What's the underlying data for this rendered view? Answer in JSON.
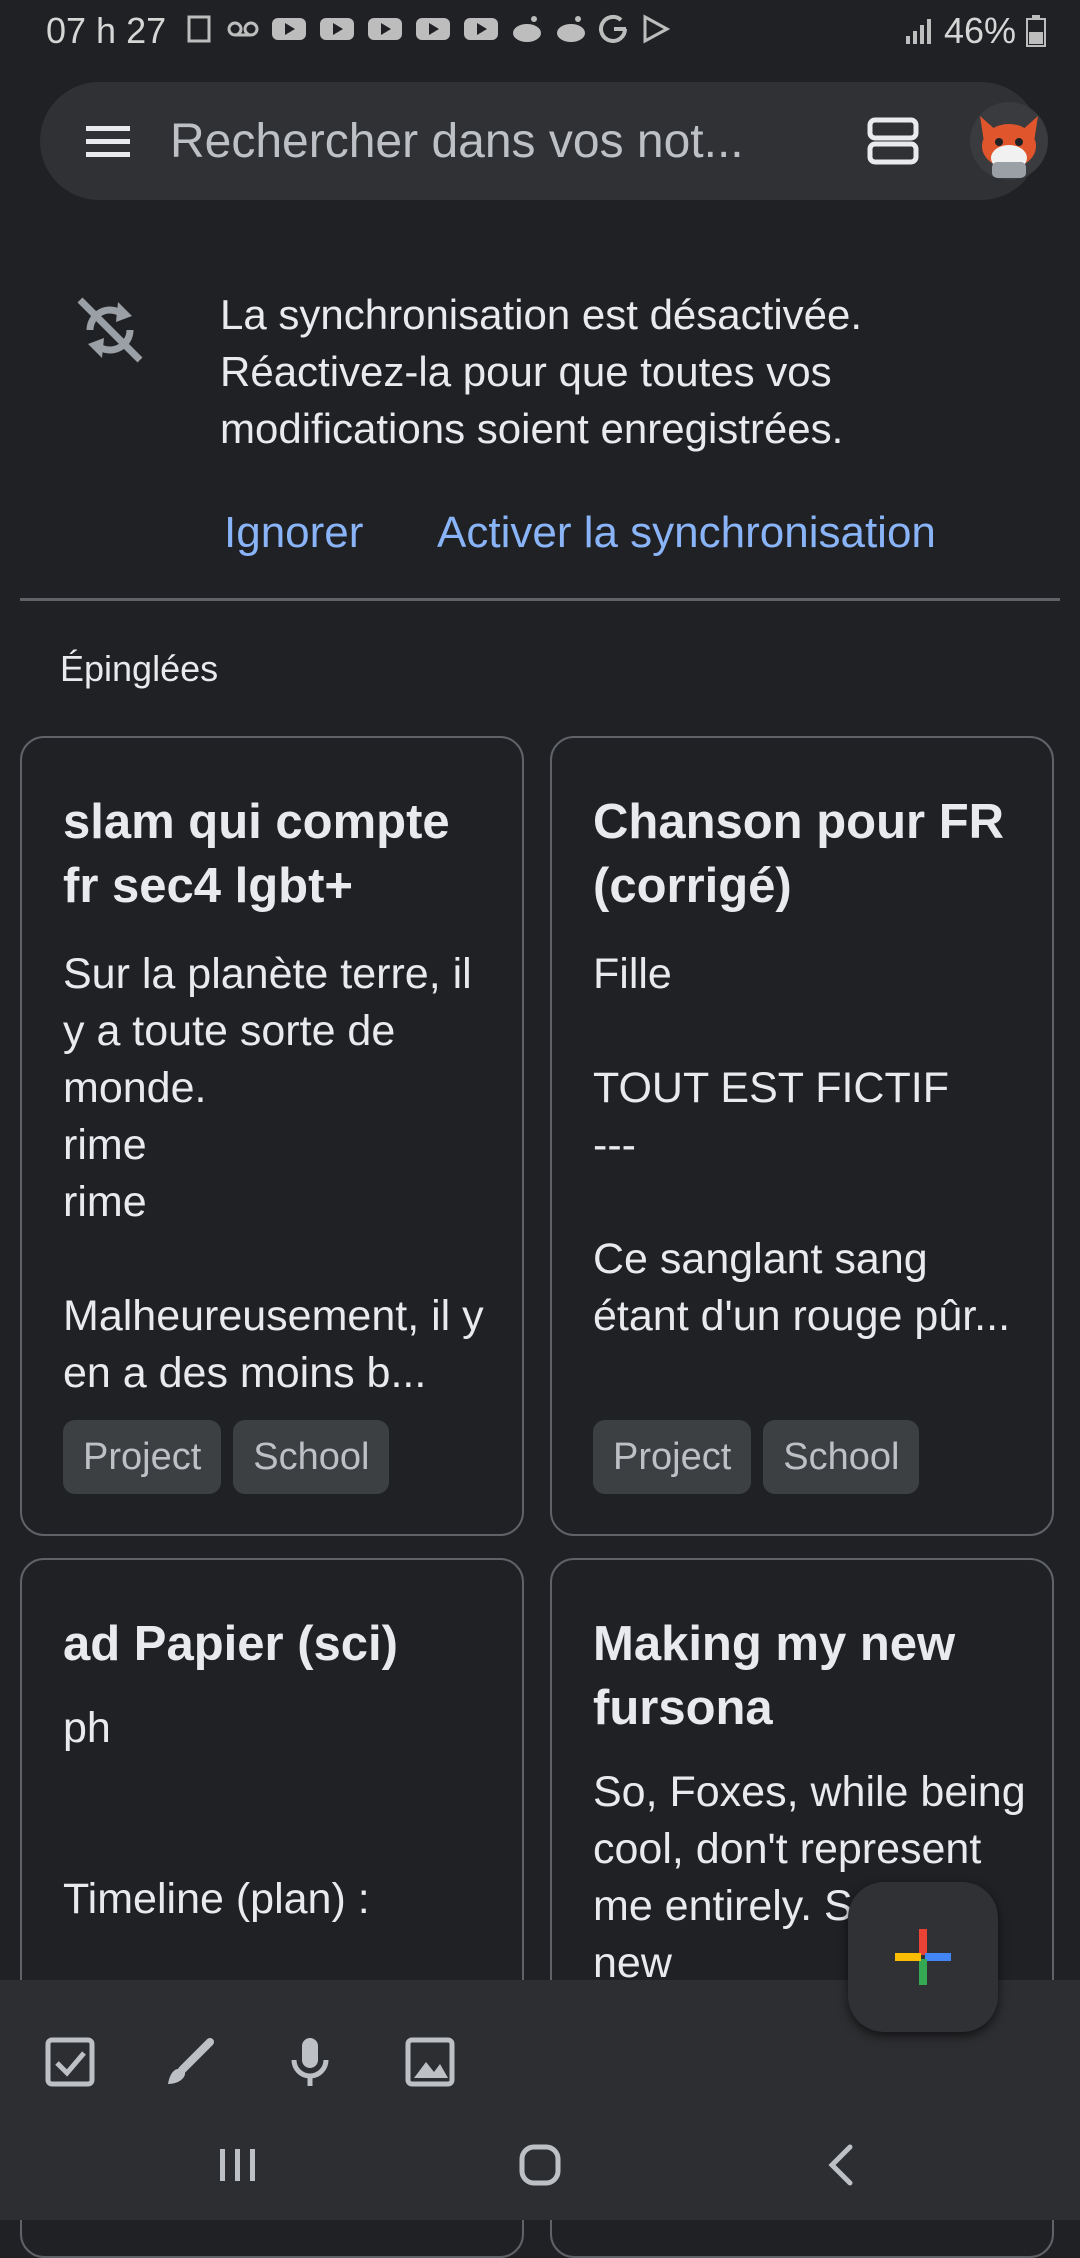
{
  "status_bar": {
    "time": "07 h 27",
    "battery": "46%"
  },
  "search": {
    "placeholder": "Rechercher dans vos not..."
  },
  "sync_banner": {
    "message": "La synchronisation est désactivée. Réactivez-la pour que toutes vos modifications soient enregistrées.",
    "ignore_label": "Ignorer",
    "activate_label": "Activer la synchronisation"
  },
  "section": {
    "pinned_label": "Épinglées"
  },
  "notes": [
    {
      "title": "slam qui compte fr sec4 lgbt+",
      "body": "Sur la planète terre, il y a toute sorte de monde.\nrime\nrime\n\nMalheureusement, il y en a des moins b...",
      "labels": [
        "Project",
        "School"
      ]
    },
    {
      "title": "Chanson pour FR (corrigé)",
      "body": "Fille\n\nTOUT EST FICTIF\n---\n\nCe sanglant sang étant d'un rouge pûr...",
      "labels": [
        "Project",
        "School"
      ]
    },
    {
      "title": "ad Papier (sci)",
      "body": "ph\n\n\nTimeline (plan) :",
      "labels": []
    },
    {
      "title": "Making my new fursona",
      "body": "So, Foxes, while being cool, don't represent me entirely. So w... a new",
      "labels": []
    }
  ],
  "colors": {
    "background": "#202124",
    "accent": "#8ab4f8",
    "card_border": "#5f6368",
    "chip": "#3c4043"
  },
  "icons": {
    "menu": "hamburger-menu-icon",
    "layout": "grid-view-icon",
    "sync_off": "sync-disabled-icon",
    "fab": "plus-icon",
    "checkbox": "checkbox-icon",
    "brush": "brush-icon",
    "mic": "microphone-icon",
    "image": "image-icon"
  }
}
